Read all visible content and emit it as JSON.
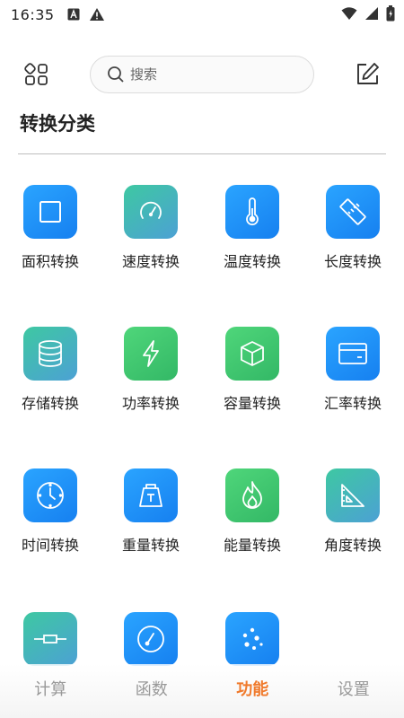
{
  "status": {
    "time": "16:35"
  },
  "search": {
    "placeholder": "搜索"
  },
  "section": {
    "title": "转换分类"
  },
  "items": [
    {
      "label": "面积转换",
      "icon": "square-icon",
      "color": "blue"
    },
    {
      "label": "速度转换",
      "icon": "speedometer-icon",
      "color": "teal"
    },
    {
      "label": "温度转换",
      "icon": "thermometer-icon",
      "color": "blue"
    },
    {
      "label": "长度转换",
      "icon": "ruler-icon",
      "color": "blue"
    },
    {
      "label": "存储转换",
      "icon": "database-icon",
      "color": "teal"
    },
    {
      "label": "功率转换",
      "icon": "lightning-icon",
      "color": "green"
    },
    {
      "label": "容量转换",
      "icon": "cube-icon",
      "color": "green"
    },
    {
      "label": "汇率转换",
      "icon": "card-icon",
      "color": "blue"
    },
    {
      "label": "时间转换",
      "icon": "clock-icon",
      "color": "blue"
    },
    {
      "label": "重量转换",
      "icon": "weight-icon",
      "color": "blue"
    },
    {
      "label": "能量转换",
      "icon": "flame-icon",
      "color": "green"
    },
    {
      "label": "角度转换",
      "icon": "triangle-ruler-icon",
      "color": "teal"
    },
    {
      "label": "",
      "icon": "resistor-icon",
      "color": "teal"
    },
    {
      "label": "",
      "icon": "compass-icon",
      "color": "blue"
    },
    {
      "label": "",
      "icon": "dots-icon",
      "color": "blue"
    }
  ],
  "nav": [
    {
      "label": "计算",
      "active": false
    },
    {
      "label": "函数",
      "active": false
    },
    {
      "label": "功能",
      "active": true
    },
    {
      "label": "设置",
      "active": false
    }
  ],
  "colors": {
    "active_tab": "#f07a2c",
    "blue_tile": "#1e90ff",
    "green_tile": "#43c672",
    "teal_tile": "#44b6b8"
  }
}
